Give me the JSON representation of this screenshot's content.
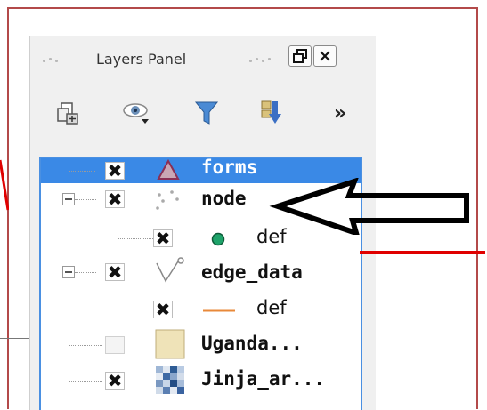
{
  "panel": {
    "title": "Layers Panel",
    "window_buttons": [
      {
        "name": "float-button",
        "glyph": "🗗"
      },
      {
        "name": "close-button",
        "glyph": "✕"
      }
    ]
  },
  "toolbar": {
    "items": [
      {
        "name": "add-group-icon"
      },
      {
        "name": "visibility-icon"
      },
      {
        "name": "filter-icon"
      },
      {
        "name": "expand-all-icon"
      },
      {
        "name": "overflow-icon",
        "glyph": "»"
      }
    ]
  },
  "layers": [
    {
      "name": "forms",
      "checked": true,
      "selected": true,
      "icon": "polygon-icon",
      "indent": 0
    },
    {
      "name": "node",
      "checked": true,
      "selected": false,
      "icon": "points-icon",
      "indent": 0,
      "expanded": true
    },
    {
      "name": "def",
      "checked": true,
      "selected": false,
      "icon": "green-circle-icon",
      "indent": 1,
      "style": "plain"
    },
    {
      "name": "edge_data",
      "checked": true,
      "selected": false,
      "icon": "line-icon",
      "indent": 0,
      "expanded": true
    },
    {
      "name": "def",
      "checked": true,
      "selected": false,
      "icon": "orange-line-icon",
      "indent": 1,
      "style": "plain"
    },
    {
      "name": "Uganda...",
      "checked": false,
      "selected": false,
      "icon": "raster-tan-icon",
      "indent": 0
    },
    {
      "name": "Jinja_ar...",
      "checked": true,
      "selected": false,
      "icon": "raster-blue-icon",
      "indent": 0
    }
  ],
  "check_glyph": "✖",
  "colors": {
    "selection": "#3a89e6",
    "annotation_red": "#e00000",
    "tree_border": "#4a90e2"
  }
}
